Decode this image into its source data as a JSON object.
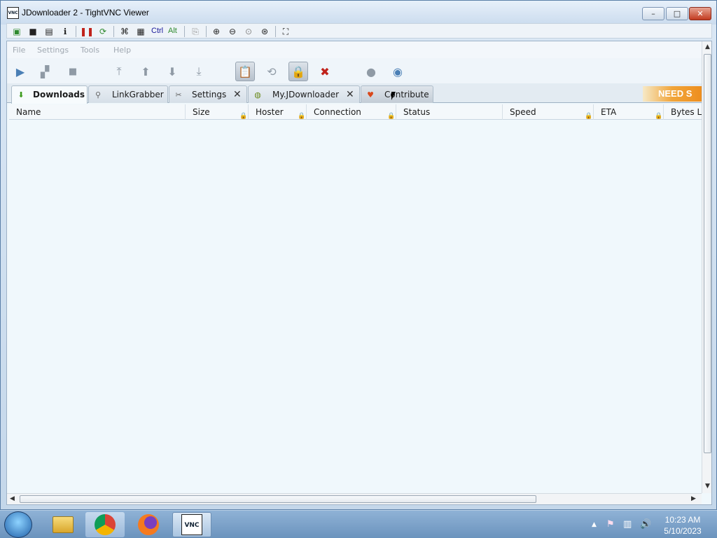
{
  "window": {
    "title": "JDownloader 2 - TightVNC Viewer",
    "app_icon_text": "VNC",
    "minimize": "–",
    "maximize": "□",
    "close": "✕"
  },
  "vnc_toolbar": {
    "ctrl_label": "Ctrl",
    "alt_label": "Alt"
  },
  "menu": {
    "items": [
      "File",
      "Settings",
      "Tools",
      "Help"
    ]
  },
  "tabs": [
    {
      "label": "Downloads"
    },
    {
      "label": "LinkGrabber"
    },
    {
      "label": "Settings"
    },
    {
      "label": "My.JDownloader"
    },
    {
      "label": "Contribute"
    }
  ],
  "banner_text": "NEED S",
  "table": {
    "columns": [
      "Name",
      "Size",
      "Hoster",
      "Connection",
      "Status",
      "Speed",
      "ETA",
      "Bytes L"
    ]
  },
  "taskbar": {
    "time": "10:23 AM",
    "date": "5/10/2023",
    "vnc_text": "VNC"
  },
  "colors": {
    "accent": "#3a7d1a",
    "banner": "#f1a53a"
  }
}
